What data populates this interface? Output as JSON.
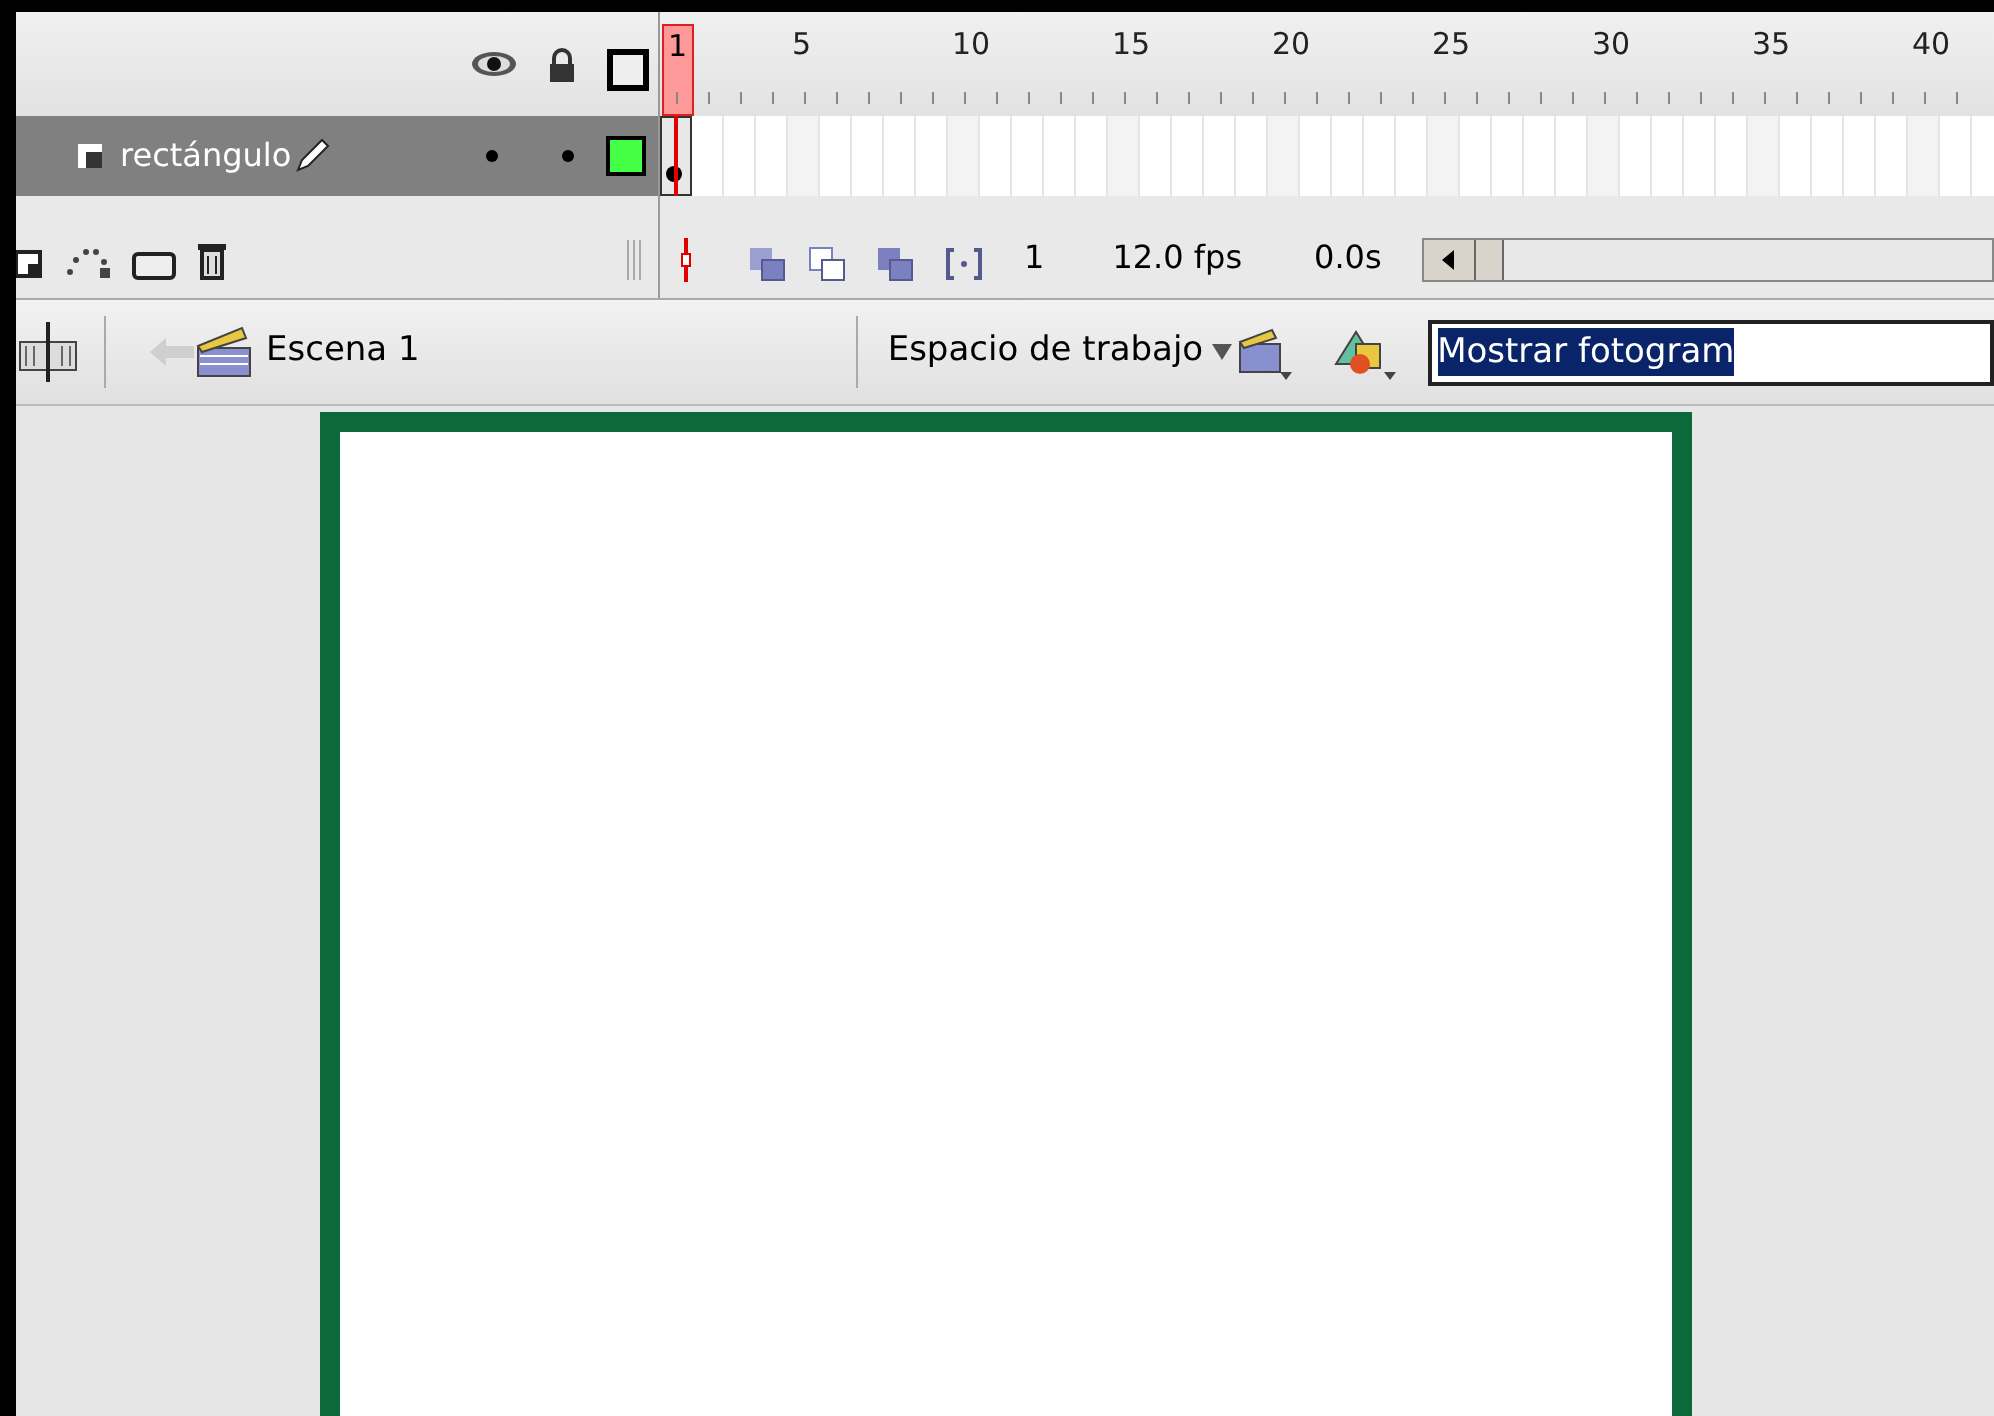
{
  "timeline": {
    "frame_labels": [
      {
        "label": "1",
        "selected": true
      },
      {
        "label": "5",
        "selected": false
      },
      {
        "label": "10",
        "selected": false
      },
      {
        "label": "15",
        "selected": false
      },
      {
        "label": "20",
        "selected": false
      },
      {
        "label": "25",
        "selected": false
      },
      {
        "label": "30",
        "selected": false
      },
      {
        "label": "35",
        "selected": false
      },
      {
        "label": "40",
        "selected": false
      }
    ],
    "layers": [
      {
        "name": "rectángulo",
        "selected": true,
        "visible": true,
        "locked": false
      }
    ],
    "status": {
      "current_frame": "1",
      "frame_rate": "12.0 fps",
      "elapsed": "0.0s"
    }
  },
  "edit_bar": {
    "back_disabled": true,
    "scene": "Escena 1",
    "workspace": "Espacio de trabajo",
    "zoom_field": {
      "value": "Mostrar fotogram",
      "highlighted": true
    }
  }
}
